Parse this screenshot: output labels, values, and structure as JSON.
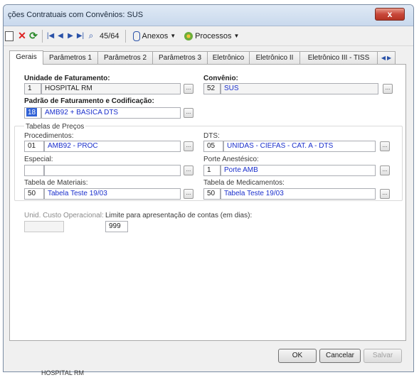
{
  "window": {
    "title": "ções Contratuais com Convênios: SUS",
    "close": "x"
  },
  "toolbar": {
    "record_counter": "45/64",
    "anexos": "Anexos",
    "processos": "Processos"
  },
  "tabs": [
    {
      "label": "Gerais"
    },
    {
      "label": "Parâmetros 1"
    },
    {
      "label": "Parâmetros 2"
    },
    {
      "label": "Parâmetros 3"
    },
    {
      "label": "Eletrônico"
    },
    {
      "label": "Eletrônico II"
    },
    {
      "label": "Eletrônico III - TISS"
    }
  ],
  "form": {
    "unidade_label": "Unidade de Faturamento:",
    "unidade_code": "1",
    "unidade_name": "HOSPITAL RM",
    "convenio_label": "Convênio:",
    "convenio_code": "52",
    "convenio_name": "SUS",
    "padrao_label": "Padrão de Faturamento e Codificação:",
    "padrao_code": "18",
    "padrao_name": "AMB92 + BASICA DTS",
    "group_title": "Tabelas de Preços",
    "proc_label": "Procedimentos:",
    "proc_code": "01",
    "proc_name": "AMB92 - PROC",
    "dts_label": "DTS:",
    "dts_code": "05",
    "dts_name": "UNIDAS - CIEFAS - CAT. A - DTS",
    "especial_label": "Especial:",
    "especial_code": "",
    "especial_name": "",
    "porte_label": "Porte Anestésico:",
    "porte_code": "1",
    "porte_name": "Porte AMB",
    "materiais_label": "Tabela de Materiais:",
    "materiais_code": "50",
    "materiais_name": "Tabela Teste 19/03",
    "medicamentos_label": "Tabela de Medicamentos:",
    "medicamentos_code": "50",
    "medicamentos_name": "Tabela Teste 19/03",
    "custo_label": "Unid. Custo Operacional:",
    "custo_value": "",
    "limite_label": "Limite para apresentação de contas (em dias):",
    "limite_value": "999",
    "lookup_glyph": "..."
  },
  "buttons": {
    "ok": "OK",
    "cancel": "Cancelar",
    "save": "Salvar"
  },
  "status": {
    "text": "HOSPITAL RM"
  }
}
